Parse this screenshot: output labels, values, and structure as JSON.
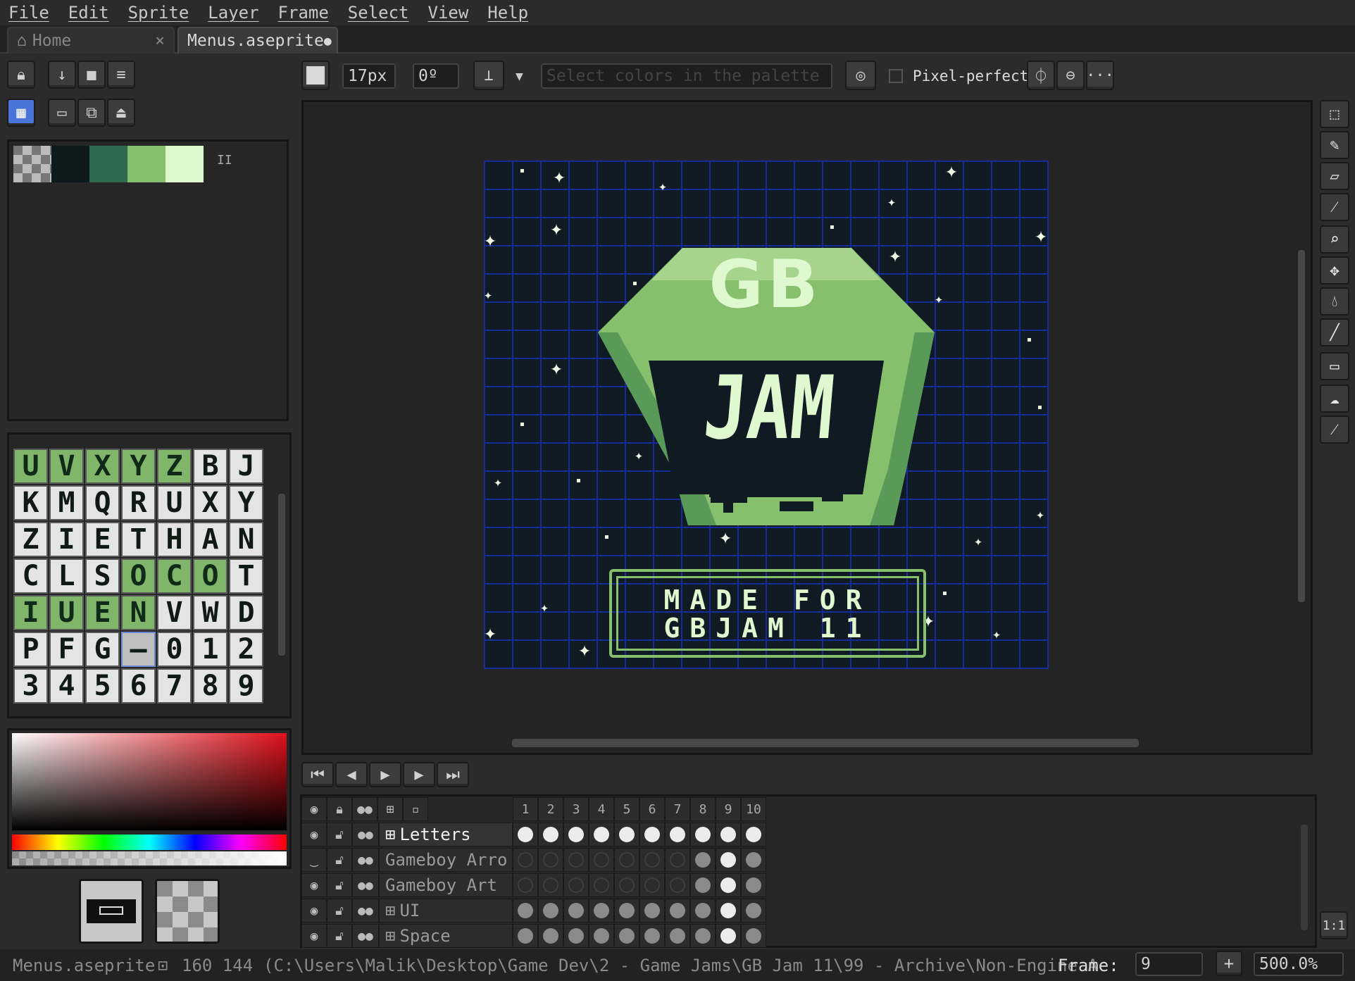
{
  "menu": [
    "File",
    "Edit",
    "Sprite",
    "Layer",
    "Frame",
    "Select",
    "View",
    "Help"
  ],
  "tabs": {
    "home": "Home",
    "home_close": "×",
    "doc": "Menus.aseprite",
    "doc_modified": "●"
  },
  "toolbar": {
    "brush_size": "17px",
    "brush_angle": "0º",
    "palette_search_placeholder": "Select colors in the palette",
    "pixel_perfect": "Pixel-perfect",
    "more": "···"
  },
  "palette": {
    "colors": [
      "#0f1a1e",
      "#2f6a4e",
      "#86c06c",
      "#e0f8cf"
    ],
    "options": "II"
  },
  "tiles": [
    [
      "U",
      "V",
      "X",
      "Y",
      "Z",
      "B",
      "J"
    ],
    [
      "K",
      "M",
      "Q",
      "R",
      "U",
      "X",
      "Y"
    ],
    [
      "Z",
      "I",
      "E",
      "T",
      "H",
      "A",
      "N"
    ],
    [
      "C",
      "L",
      "S",
      "O",
      "C",
      "O",
      "T"
    ],
    [
      "I",
      "U",
      "E",
      "N",
      "V",
      "W",
      "D"
    ],
    [
      "P",
      "F",
      "G",
      "–",
      "0",
      "1",
      "2"
    ],
    [
      "3",
      "4",
      "5",
      "6",
      "7",
      "8",
      "9"
    ]
  ],
  "canvas": {
    "logo_top": "GB",
    "logo_main": "JAM",
    "sign_line1": "MADE FOR",
    "sign_line2": "GBJAM 11"
  },
  "timeline": {
    "frames": [
      "1",
      "2",
      "3",
      "4",
      "5",
      "6",
      "7",
      "8",
      "9",
      "10"
    ],
    "layers": [
      {
        "name": "Letters",
        "tilemap": true,
        "selected": true,
        "cels": [
          "full",
          "full",
          "full",
          "full",
          "full",
          "full",
          "full",
          "full",
          "full",
          "full"
        ]
      },
      {
        "name": "Gameboy Arro",
        "tilemap": false,
        "selected": false,
        "cels": [
          "empty",
          "empty",
          "empty",
          "empty",
          "empty",
          "empty",
          "empty",
          "mid",
          "full",
          "mid"
        ]
      },
      {
        "name": "Gameboy Art",
        "tilemap": false,
        "selected": false,
        "cels": [
          "empty",
          "empty",
          "empty",
          "empty",
          "empty",
          "empty",
          "empty",
          "mid",
          "full",
          "mid"
        ]
      },
      {
        "name": "UI",
        "tilemap": true,
        "selected": false,
        "cels": [
          "mid",
          "mid",
          "mid",
          "mid",
          "mid",
          "mid",
          "mid",
          "mid",
          "full",
          "mid"
        ]
      },
      {
        "name": "Space",
        "tilemap": true,
        "selected": false,
        "cels": [
          "mid",
          "mid",
          "mid",
          "mid",
          "mid",
          "mid",
          "mid",
          "mid",
          "full",
          "mid"
        ]
      }
    ]
  },
  "status": {
    "filename": "Menus.aseprite",
    "size": "160 144",
    "path": "(C:\\Users\\Malik\\Desktop\\Game Dev\\2 - Game Jams\\GB Jam 11\\99 - Archive\\Non-Engine A",
    "frame_label": "Frame:",
    "frame_value": "9",
    "add_frame": "+",
    "zoom": "500.0%",
    "zoom_reset": "1:1"
  }
}
